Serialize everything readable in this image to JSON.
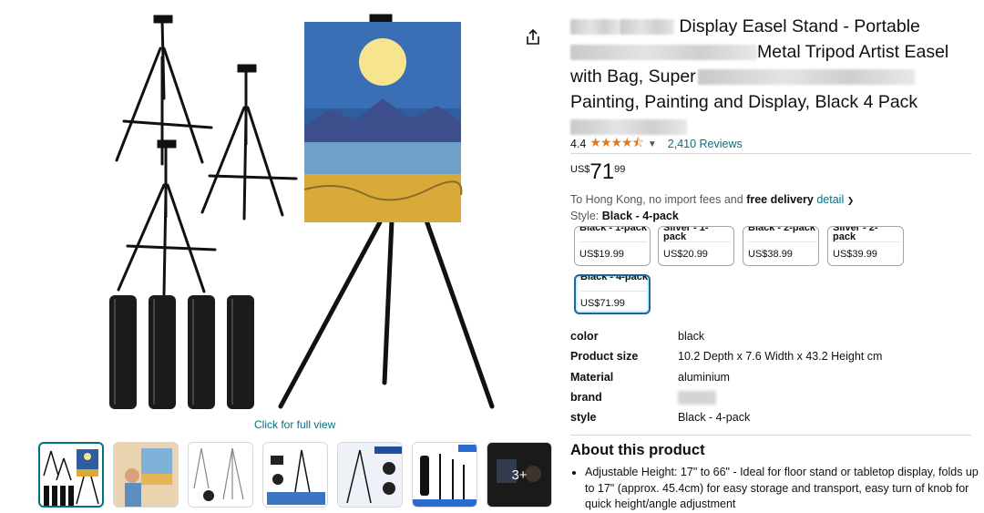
{
  "gallery": {
    "full_view_link": "Click for full view",
    "thumbnails": [
      {
        "name": "thumb-easel-set"
      },
      {
        "name": "thumb-child-painting"
      },
      {
        "name": "thumb-easel-angles"
      },
      {
        "name": "thumb-accessories"
      },
      {
        "name": "thumb-easel-features"
      },
      {
        "name": "thumb-pack-parts"
      },
      {
        "name": "thumb-more",
        "overlay": "3+"
      }
    ],
    "colors": {
      "accent": "#007185",
      "sky": "#2f5d9e",
      "moon": "#f6e58d",
      "field": "#d9a93a",
      "mountain": "#3e4f8e"
    }
  },
  "product": {
    "title_line1": "Display Easel Stand - Portable",
    "title_line2": "Metal Tripod Artist Easel",
    "title_line3": "with Bag, Super",
    "title_line4": "Painting, Painting and Display, Black 4 Pack",
    "rating": "4.4",
    "stars": "★★★★⯪",
    "reviews": "2,410 Reviews",
    "price": {
      "currency": "US$",
      "whole": "71",
      "fraction": "99"
    },
    "delivery_prefix": "To Hong Kong, no import fees and ",
    "delivery_bold": "free delivery",
    "delivery_link": "detail",
    "style_label": "Style: ",
    "style_value": "Black - 4-pack"
  },
  "variants": [
    {
      "name": "Black - 1-pack",
      "price": "US$19.99",
      "selected": false
    },
    {
      "name": "Silver - 1-pack",
      "price": "US$20.99",
      "selected": false
    },
    {
      "name": "Black - 2-pack",
      "price": "US$38.99",
      "selected": false
    },
    {
      "name": "Silver - 2-pack",
      "price": "US$39.99",
      "selected": false
    },
    {
      "name": "Black - 4-pack",
      "price": "US$71.99",
      "selected": true
    }
  ],
  "specs": [
    {
      "key": "color",
      "value": "black"
    },
    {
      "key": "Product size",
      "value": "10.2 Depth x 7.6 Width x 43.2 Height cm"
    },
    {
      "key": "Material",
      "value": "aluminium"
    },
    {
      "key": "brand",
      "value": ""
    },
    {
      "key": "style",
      "value": "Black - 4-pack"
    }
  ],
  "about": {
    "heading": "About this product",
    "bullet1": "Adjustable Height: 17\" to 66\" - Ideal for floor stand or tabletop display, folds up to 17\" (approx. 45.4cm) for easy storage and transport, easy turn of knob for quick height/angle adjustment"
  }
}
